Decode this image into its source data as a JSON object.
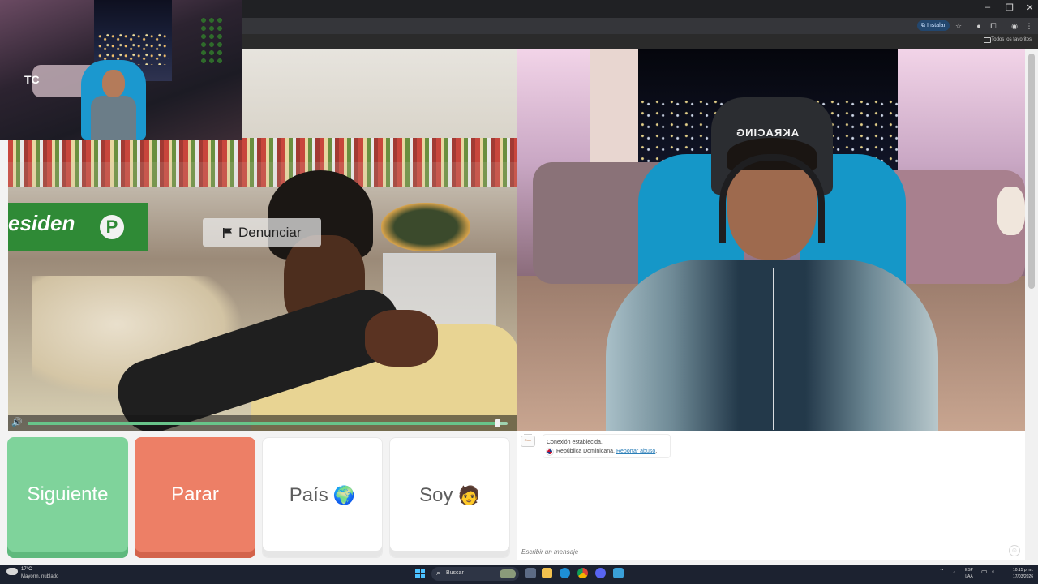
{
  "browser": {
    "install_label": "Instalar",
    "bookmarks_label": "Todos los favoritos"
  },
  "webcam": {
    "overlay_text": "TC"
  },
  "video_left": {
    "report_label": "Denunciar",
    "sign_text": "esiden",
    "sign_badge": "P",
    "progress": 0.98
  },
  "video_right": {
    "chair_brand": "AKRACING"
  },
  "buttons": {
    "next_label": "Siguiente",
    "stop_label": "Parar",
    "country_label": "País",
    "country_emoji": "🌍",
    "me_label": "Soy",
    "me_emoji": "🧑"
  },
  "chat": {
    "logo_text": "Ome",
    "status": "Conexión establecida.",
    "country": "República Dominicana.",
    "report_link": "Reportar abuso",
    "report_dot": ".",
    "input_placeholder": "Escribir un mensaje"
  },
  "taskbar": {
    "temperature": "17°C",
    "weather": "Mayorm. nublado",
    "search_label": "Buscar",
    "lang_top": "ESP",
    "lang_bottom": "LAA",
    "time": "10:15 p. m.",
    "date": "17/03/2026"
  },
  "colors": {
    "next": "#7fd39b",
    "stop": "#ed7f66",
    "link": "#2c7fb8"
  }
}
